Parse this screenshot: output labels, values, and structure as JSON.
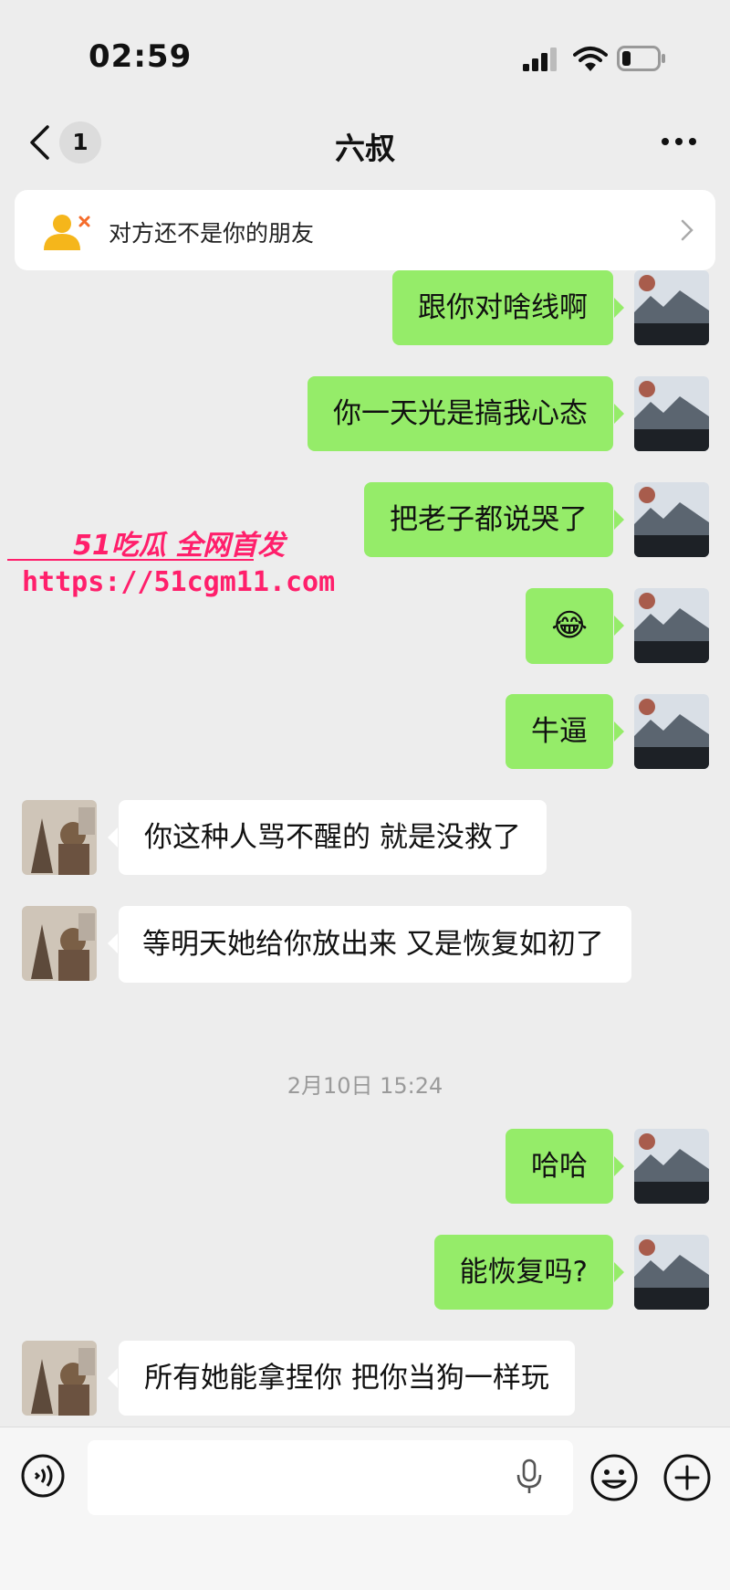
{
  "status_bar": {
    "time": "02:59",
    "battery_level": 0.25
  },
  "header": {
    "unread_count": "1",
    "title": "六叔"
  },
  "banner": {
    "text": "对方还不是你的朋友",
    "icon": "stranger-icon"
  },
  "watermark": {
    "brand": "51吃瓜 全网首发",
    "url": "https://51cgm11.com"
  },
  "messages": [
    {
      "sender": "me",
      "text": "跟你对啥线啊"
    },
    {
      "sender": "me",
      "text": "你一天光是搞我心态"
    },
    {
      "sender": "me",
      "text": "把老子都说哭了"
    },
    {
      "sender": "me",
      "text": "😂"
    },
    {
      "sender": "me",
      "text": "牛逼"
    },
    {
      "sender": "them",
      "text": "你这种人骂不醒的 就是没救了"
    },
    {
      "sender": "them",
      "text": "等明天她给你放出来 又是恢复如初了"
    },
    {
      "sender": "me",
      "text": "哈哈"
    },
    {
      "sender": "me",
      "text": "能恢复吗?"
    },
    {
      "sender": "them",
      "text": "所有她能拿捏你 把你当狗一样玩"
    }
  ],
  "timestamp": "2月10日 15:24",
  "colors": {
    "my_bubble": "#95ec69",
    "their_bubble": "#ffffff",
    "background": "#ededed",
    "watermark": "#ff1f6b"
  }
}
